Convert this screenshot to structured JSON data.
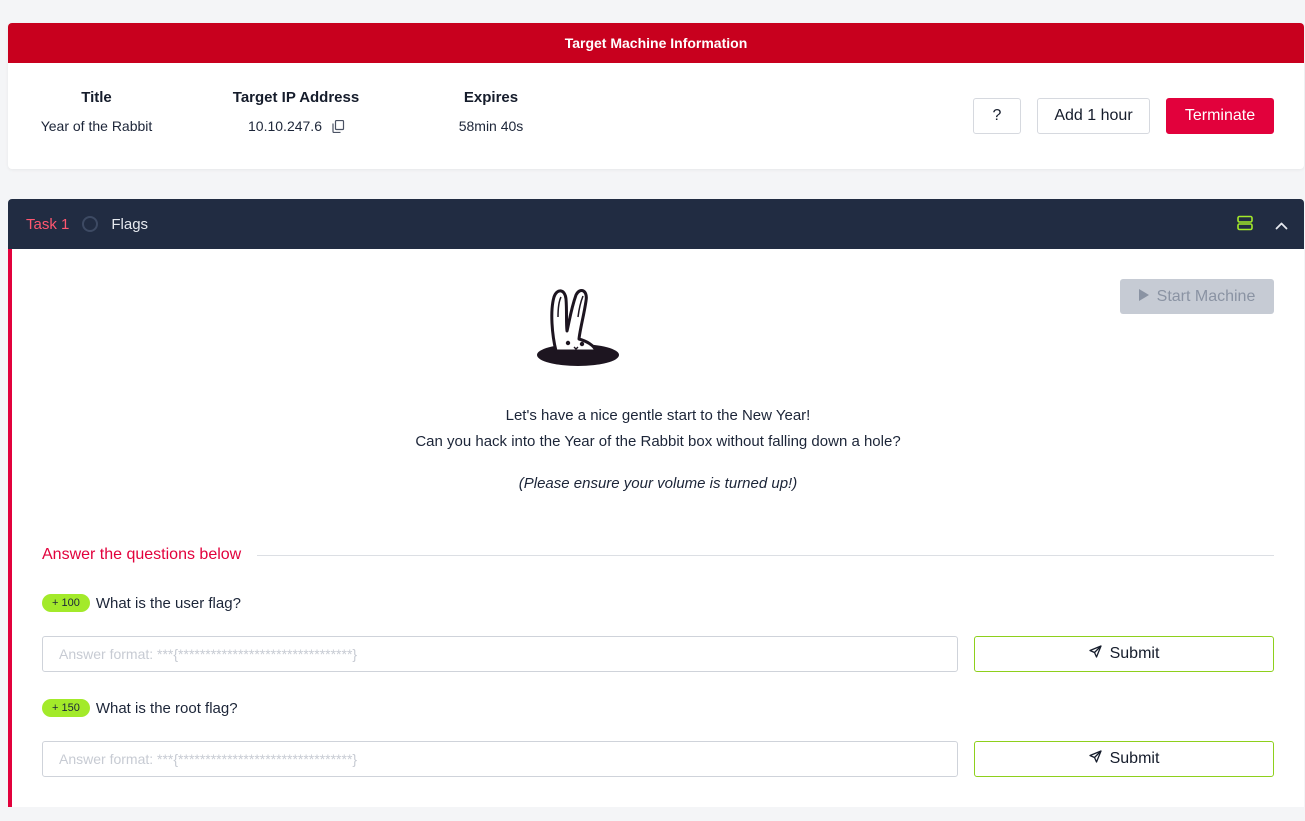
{
  "machine": {
    "header": "Target Machine Information",
    "title_label": "Title",
    "title_value": "Year of the Rabbit",
    "ip_label": "Target IP Address",
    "ip_value": "10.10.247.6",
    "expires_label": "Expires",
    "expires_value": "58min 40s",
    "help_label": "?",
    "add_hour_label": "Add 1 hour",
    "terminate_label": "Terminate"
  },
  "task": {
    "number": "Task 1",
    "title": "Flags",
    "start_machine_label": "Start Machine",
    "description_line1": "Let's have a nice gentle start to the New Year!",
    "description_line2": "Can you hack into the Year of the Rabbit box without falling down a hole?",
    "description_note": "(Please ensure your volume is turned up!)",
    "questions_heading": "Answer the questions below",
    "questions": [
      {
        "points": "+ 100",
        "text": "What is the user flag?",
        "placeholder": "Answer format: ***{********************************}",
        "submit_label": "Submit"
      },
      {
        "points": "+ 150",
        "text": "What is the root flag?",
        "placeholder": "Answer format: ***{********************************}",
        "submit_label": "Submit"
      }
    ]
  },
  "colors": {
    "header_red": "#c8001e",
    "accent_red": "#e2013c",
    "task_bar": "#212c42",
    "points_green": "#a3ea2a",
    "submit_border": "#8ed01c"
  },
  "icons": [
    "copy-icon",
    "task-status-icon",
    "split-view-icon",
    "chevron-up-icon",
    "play-icon",
    "send-icon",
    "rabbit-illustration"
  ]
}
